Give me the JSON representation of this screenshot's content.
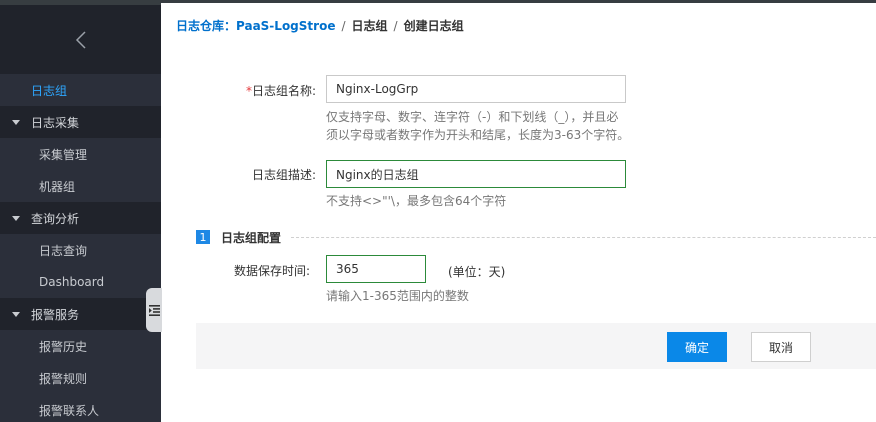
{
  "breadcrumb": {
    "root": "日志仓库：PaaS-LogStroe",
    "sep1": "/",
    "level2": "日志组",
    "sep2": "/",
    "current": "创建日志组"
  },
  "sidebar": {
    "collapse_icon": "chevron-left-icon",
    "items": [
      {
        "label": "日志组",
        "type": "active-top"
      },
      {
        "label": "日志采集",
        "type": "group"
      },
      {
        "label": "采集管理",
        "type": "sub"
      },
      {
        "label": "机器组",
        "type": "sub"
      },
      {
        "label": "查询分析",
        "type": "group"
      },
      {
        "label": "日志查询",
        "type": "sub"
      },
      {
        "label": "Dashboard",
        "type": "sub"
      },
      {
        "label": "报警服务",
        "type": "group"
      },
      {
        "label": "报警历史",
        "type": "sub"
      },
      {
        "label": "报警规则",
        "type": "sub"
      },
      {
        "label": "报警联系人",
        "type": "sub"
      }
    ],
    "handle_icon": "list-indent-icon"
  },
  "form": {
    "name_required_mark": "*",
    "name_label": "日志组名称:",
    "name_value": "Nginx-LogGrp",
    "name_hint_1": "仅支持字母、数字、连字符（-）和下划线（_），并且必",
    "name_hint_2": "须以字母或者数字作为开头和结尾，长度为3-63个字符。",
    "desc_label": "日志组描述:",
    "desc_value": "Nginx的日志组",
    "desc_hint": "不支持<>\"'\\，最多包含64个字符",
    "section_number": "1",
    "section_title": "日志组配置",
    "retention_label": "数据保存时间:",
    "retention_value": "365",
    "retention_unit": "(单位：天)",
    "retention_hint": "请输入1-365范围内的整数"
  },
  "buttons": {
    "confirm": "确定",
    "cancel": "取消"
  },
  "colors": {
    "sidebar_bg": "#2b2f3a",
    "sidebar_group_bg": "#20232b",
    "active": "#2ea7ff",
    "link": "#0070cc",
    "valid_border": "#2c8a3a",
    "primary": "#0a88e8"
  }
}
